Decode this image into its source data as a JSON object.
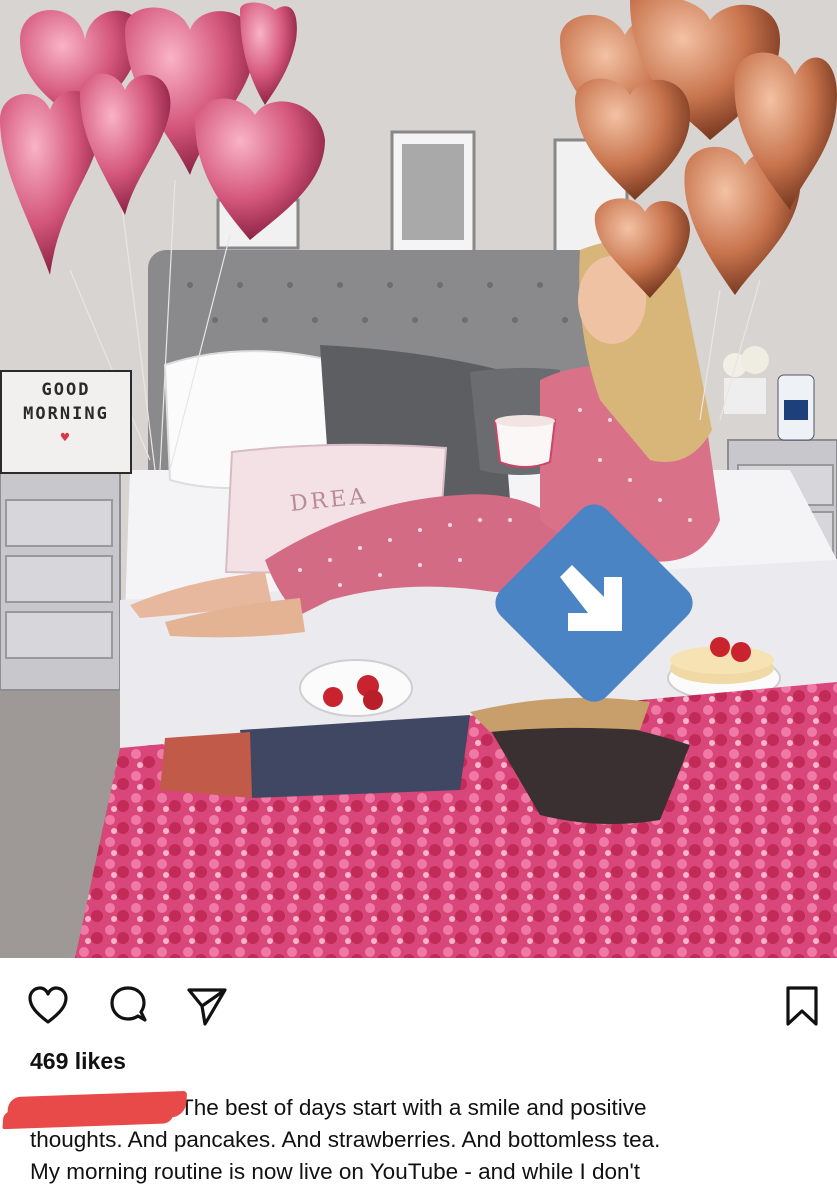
{
  "post": {
    "sign_line1": "GOOD",
    "sign_line2": "MORNING",
    "pillow_text": "DREA",
    "likes": "469 likes",
    "caption_line1": "The best of days start with a smile and positive",
    "caption_line2": "thoughts. And pancakes. And strawberries. And bottomless tea.",
    "caption_line3": "My morning routine is now live on YouTube - and while I don't"
  },
  "icons": {
    "like": "heart-outline-icon",
    "comment": "comment-bubble-icon",
    "share": "paper-plane-icon",
    "save": "bookmark-icon",
    "overlay": "arrow-down-right-icon"
  },
  "colors": {
    "overlay_badge": "#4a84c4",
    "redaction": "#e84a4a",
    "text": "#111111"
  }
}
